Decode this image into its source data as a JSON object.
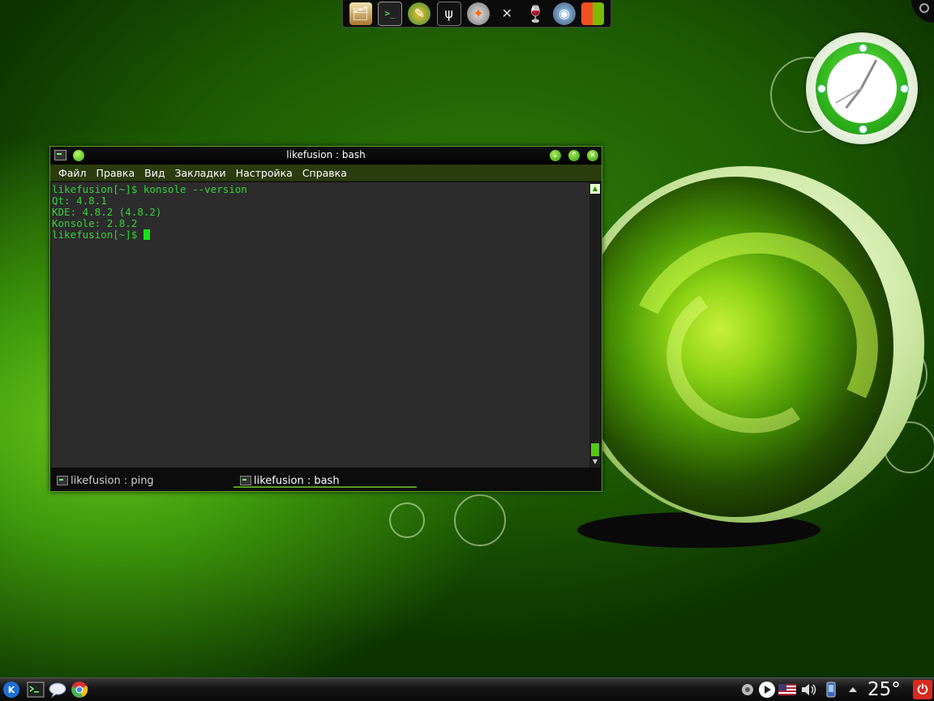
{
  "launcher": {
    "icons": [
      "files-icon",
      "terminal-icon",
      "paint-icon",
      "usb-icon",
      "cd-burn-icon",
      "satellite-icon",
      "wine-icon",
      "webcam-icon",
      "windows-icon"
    ]
  },
  "konsole": {
    "title": "likefusion : bash",
    "menu": [
      "Файл",
      "Правка",
      "Вид",
      "Закладки",
      "Настройка",
      "Справка"
    ],
    "terminal_lines": [
      "likefusion[~]$ konsole --version",
      "Qt: 4.8.1",
      "KDE: 4.8.2 (4.8.2)",
      "Konsole: 2.8.2"
    ],
    "prompt": "likefusion[~]$ ",
    "tabs": [
      {
        "label": "likefusion : ping",
        "active": false
      },
      {
        "label": "likefusion : bash",
        "active": true
      }
    ],
    "colors": {
      "text": "#36d13a",
      "accent": "#5a9e1f",
      "background": "#2c2c2c"
    }
  },
  "taskbar": {
    "left_icons": [
      "kde-menu-icon",
      "terminal-icon",
      "chat-icon",
      "chrome-icon"
    ],
    "tray_icons": [
      "network-icon",
      "media-play-icon",
      "us-flag-icon",
      "volume-icon",
      "phone-icon",
      "tray-expand-icon"
    ],
    "temperature": "25°",
    "power_symbol": "⏻"
  }
}
